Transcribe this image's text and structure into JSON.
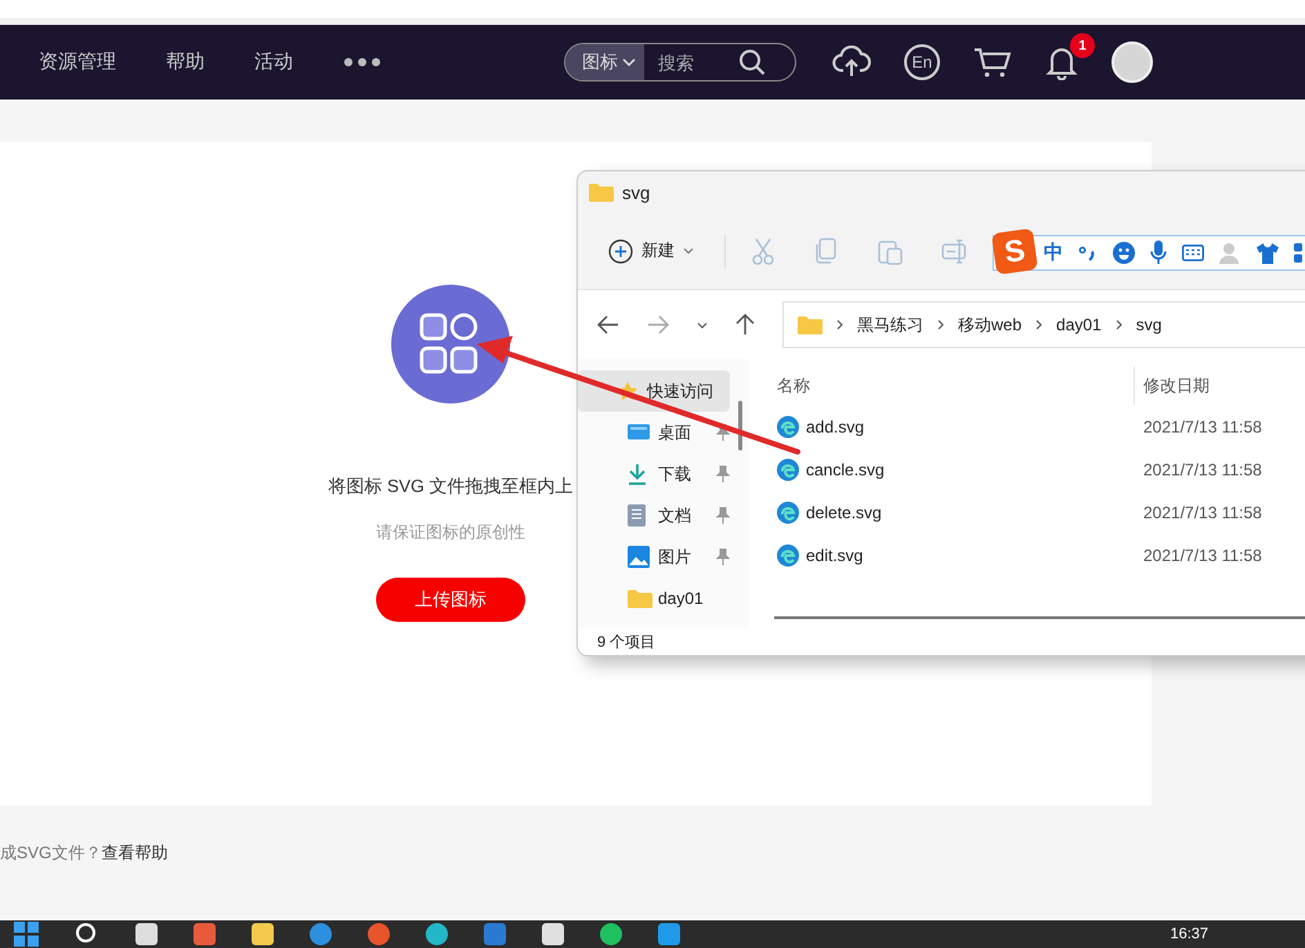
{
  "nav": {
    "items": [
      {
        "label": "资源管理"
      },
      {
        "label": "帮助"
      },
      {
        "label": "活动"
      }
    ],
    "search": {
      "scope": "图标",
      "placeholder": "搜索"
    },
    "language": "En",
    "notification_count": "1"
  },
  "upload": {
    "instruction": "将图标 SVG 文件拖拽至框内上",
    "note": "请保证图标的原创性",
    "button": "上传图标"
  },
  "help": {
    "prefix": "成SVG文件？",
    "link": "查看帮助"
  },
  "explorer": {
    "title": "svg",
    "new_button": "新建",
    "ime": {
      "logo": "S",
      "mode": "中"
    },
    "breadcrumb": [
      "黑马练习",
      "移动web",
      "day01",
      "svg"
    ],
    "sidebar": [
      {
        "label": "快速访问",
        "kind": "star",
        "pinned": false,
        "selected": true
      },
      {
        "label": "桌面",
        "kind": "desktop",
        "pinned": true,
        "selected": false
      },
      {
        "label": "下载",
        "kind": "download",
        "pinned": true,
        "selected": false
      },
      {
        "label": "文档",
        "kind": "document",
        "pinned": true,
        "selected": false
      },
      {
        "label": "图片",
        "kind": "picture",
        "pinned": true,
        "selected": false
      },
      {
        "label": "day01",
        "kind": "folder",
        "pinned": false,
        "selected": false
      }
    ],
    "columns": [
      "名称",
      "修改日期"
    ],
    "files": [
      {
        "name": "add.svg",
        "modified": "2021/7/13 11:58"
      },
      {
        "name": "cancle.svg",
        "modified": "2021/7/13 11:58"
      },
      {
        "name": "delete.svg",
        "modified": "2021/7/13 11:58"
      },
      {
        "name": "edit.svg",
        "modified": "2021/7/13 11:58"
      }
    ],
    "status": "9 个项目"
  },
  "taskbar": {
    "time": "16:37"
  }
}
